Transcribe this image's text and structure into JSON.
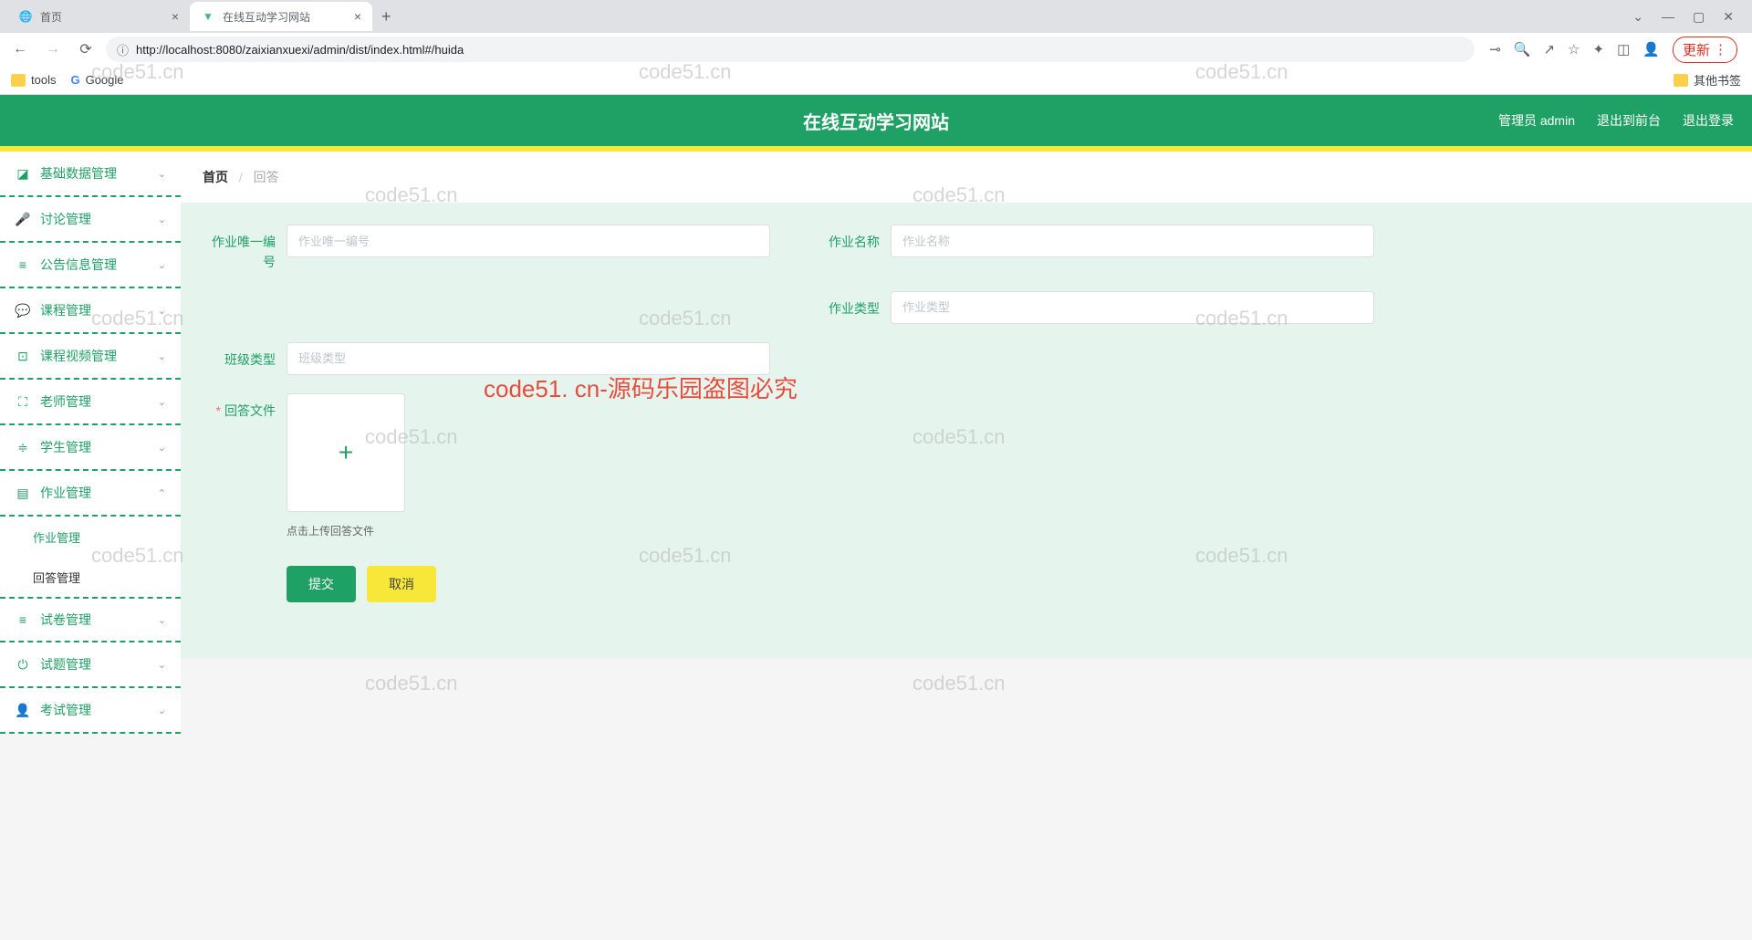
{
  "browser": {
    "tabs": [
      {
        "title": "首页",
        "favicon": "globe"
      },
      {
        "title": "在线互动学习网站",
        "favicon": "vue",
        "active": true
      }
    ],
    "url": "http://localhost:8080/zaixianxuexi/admin/dist/index.html#/huida",
    "updateLabel": "更新",
    "bookmarks": {
      "tools": "tools",
      "google": "Google",
      "other": "其他书签"
    }
  },
  "header": {
    "title": "在线互动学习网站",
    "admin": "管理员 admin",
    "goFront": "退出到前台",
    "logout": "退出登录"
  },
  "sidebar": {
    "items": [
      {
        "label": "基础数据管理",
        "icon": "note",
        "expanded": false
      },
      {
        "label": "讨论管理",
        "icon": "mic",
        "expanded": false
      },
      {
        "label": "公告信息管理",
        "icon": "list",
        "expanded": false
      },
      {
        "label": "课程管理",
        "icon": "chat",
        "expanded": false
      },
      {
        "label": "课程视频管理",
        "icon": "video",
        "expanded": false
      },
      {
        "label": "老师管理",
        "icon": "crop",
        "expanded": false
      },
      {
        "label": "学生管理",
        "icon": "settings",
        "expanded": false
      },
      {
        "label": "作业管理",
        "icon": "book",
        "expanded": true,
        "children": [
          {
            "label": "作业管理"
          },
          {
            "label": "回答管理",
            "active": true
          }
        ]
      },
      {
        "label": "试卷管理",
        "icon": "list2",
        "expanded": false
      },
      {
        "label": "试题管理",
        "icon": "power",
        "expanded": false
      },
      {
        "label": "考试管理",
        "icon": "user",
        "expanded": false
      }
    ]
  },
  "breadcrumb": {
    "home": "首页",
    "current": "回答"
  },
  "form": {
    "field1": {
      "label": "作业唯一编号",
      "placeholder": "作业唯一编号"
    },
    "field2": {
      "label": "作业名称",
      "placeholder": "作业名称"
    },
    "field3": {
      "label": "作业类型",
      "placeholder": "作业类型"
    },
    "field4": {
      "label": "班级类型",
      "placeholder": "班级类型"
    },
    "upload": {
      "label": "回答文件",
      "hint": "点击上传回答文件"
    },
    "submit": "提交",
    "cancel": "取消"
  },
  "watermarks": {
    "grey": "code51.cn",
    "red": "code51. cn-源码乐园盗图必究"
  }
}
